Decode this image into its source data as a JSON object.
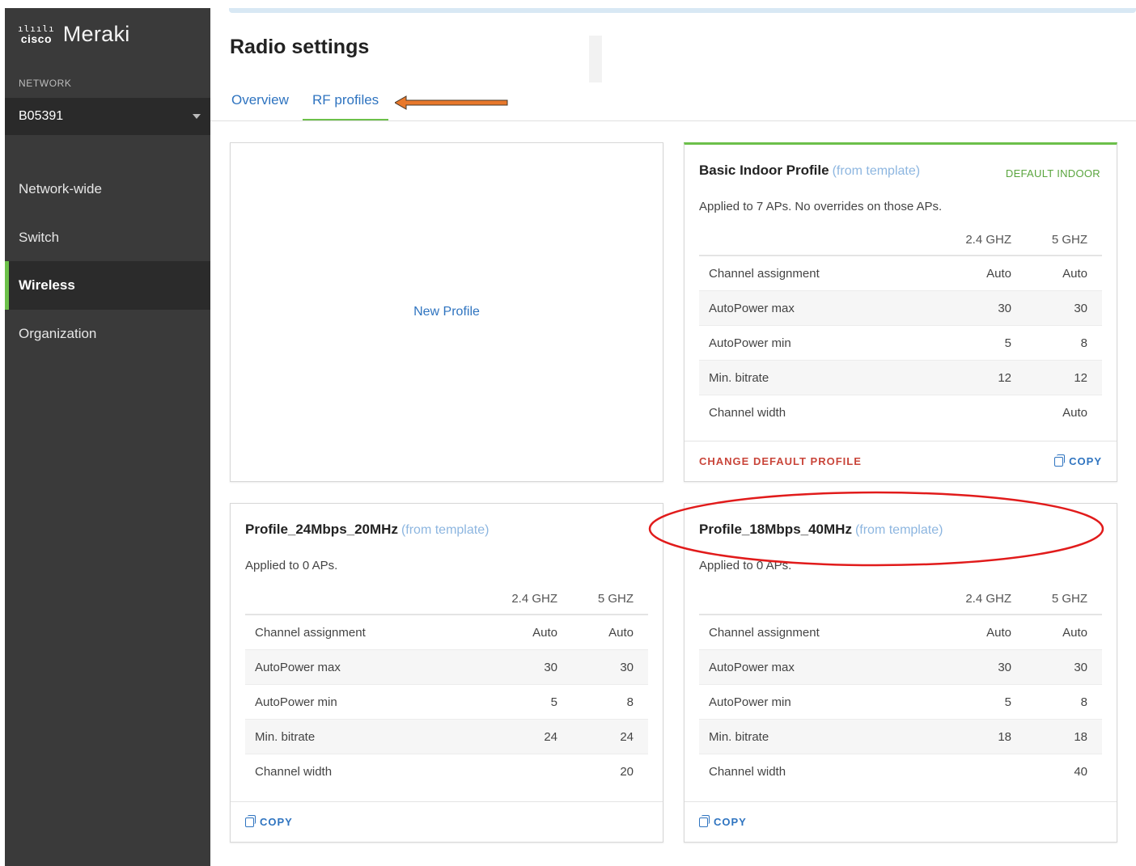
{
  "sidebar": {
    "logo_cisco": "cisco",
    "logo_product": "Meraki",
    "network_label": "NETWORK",
    "network_value": "B05391",
    "items": [
      {
        "label": "Network-wide"
      },
      {
        "label": "Switch"
      },
      {
        "label": "Wireless"
      },
      {
        "label": "Organization"
      }
    ]
  },
  "page": {
    "title": "Radio settings",
    "tabs": [
      "Overview",
      "RF profiles"
    ]
  },
  "new_profile_label": "New Profile",
  "columns": [
    "2.4 GHZ",
    "5 GHZ"
  ],
  "cards": [
    {
      "name": "Basic Indoor Profile",
      "template": "(from template)",
      "badge": "DEFAULT INDOOR",
      "applied": "Applied to 7 APs. No overrides on those APs.",
      "rows": [
        {
          "label": "Channel assignment",
          "v24": "Auto",
          "v5": "Auto"
        },
        {
          "label": "AutoPower max",
          "v24": "30",
          "v5": "30"
        },
        {
          "label": "AutoPower min",
          "v24": "5",
          "v5": "8"
        },
        {
          "label": "Min. bitrate",
          "v24": "12",
          "v5": "12"
        },
        {
          "label": "Channel width",
          "v24": "",
          "v5": "Auto"
        }
      ],
      "footer_action": "CHANGE DEFAULT PROFILE",
      "copy": "COPY"
    },
    {
      "name": "Profile_24Mbps_20MHz",
      "template": "(from template)",
      "applied": "Applied to 0 APs.",
      "rows": [
        {
          "label": "Channel assignment",
          "v24": "Auto",
          "v5": "Auto"
        },
        {
          "label": "AutoPower max",
          "v24": "30",
          "v5": "30"
        },
        {
          "label": "AutoPower min",
          "v24": "5",
          "v5": "8"
        },
        {
          "label": "Min. bitrate",
          "v24": "24",
          "v5": "24"
        },
        {
          "label": "Channel width",
          "v24": "",
          "v5": "20"
        }
      ],
      "copy": "COPY"
    },
    {
      "name": "Profile_18Mbps_40MHz",
      "template": "(from template)",
      "applied": "Applied to 0 APs.",
      "rows": [
        {
          "label": "Channel assignment",
          "v24": "Auto",
          "v5": "Auto"
        },
        {
          "label": "AutoPower max",
          "v24": "30",
          "v5": "30"
        },
        {
          "label": "AutoPower min",
          "v24": "5",
          "v5": "8"
        },
        {
          "label": "Min. bitrate",
          "v24": "18",
          "v5": "18"
        },
        {
          "label": "Channel width",
          "v24": "",
          "v5": "40"
        }
      ],
      "copy": "COPY"
    }
  ],
  "annotations": {
    "arrow_color": "#e8782b",
    "ellipse_color": "#e11b1b"
  }
}
